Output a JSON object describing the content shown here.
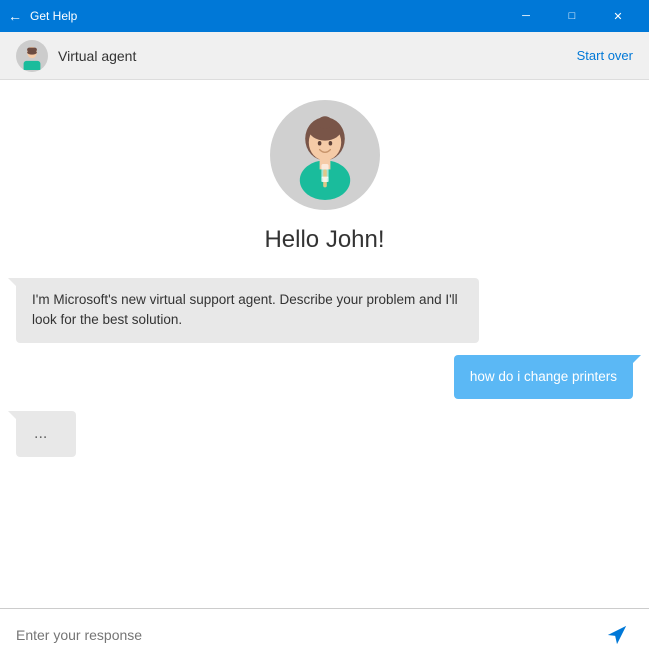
{
  "titleBar": {
    "title": "Get Help",
    "backLabel": "←",
    "minimizeLabel": "─",
    "maximizeLabel": "□",
    "closeLabel": "✕"
  },
  "header": {
    "agentName": "Virtual agent",
    "startOverLabel": "Start over"
  },
  "chat": {
    "greeting": "Hello John!",
    "messages": [
      {
        "role": "agent",
        "text": "I'm Microsoft's new virtual support agent. Describe your problem and I'll look for the best solution."
      },
      {
        "role": "user",
        "text": "how do i change printers"
      },
      {
        "role": "agent-typing",
        "text": "..."
      }
    ]
  },
  "inputArea": {
    "placeholder": "Enter your response"
  }
}
